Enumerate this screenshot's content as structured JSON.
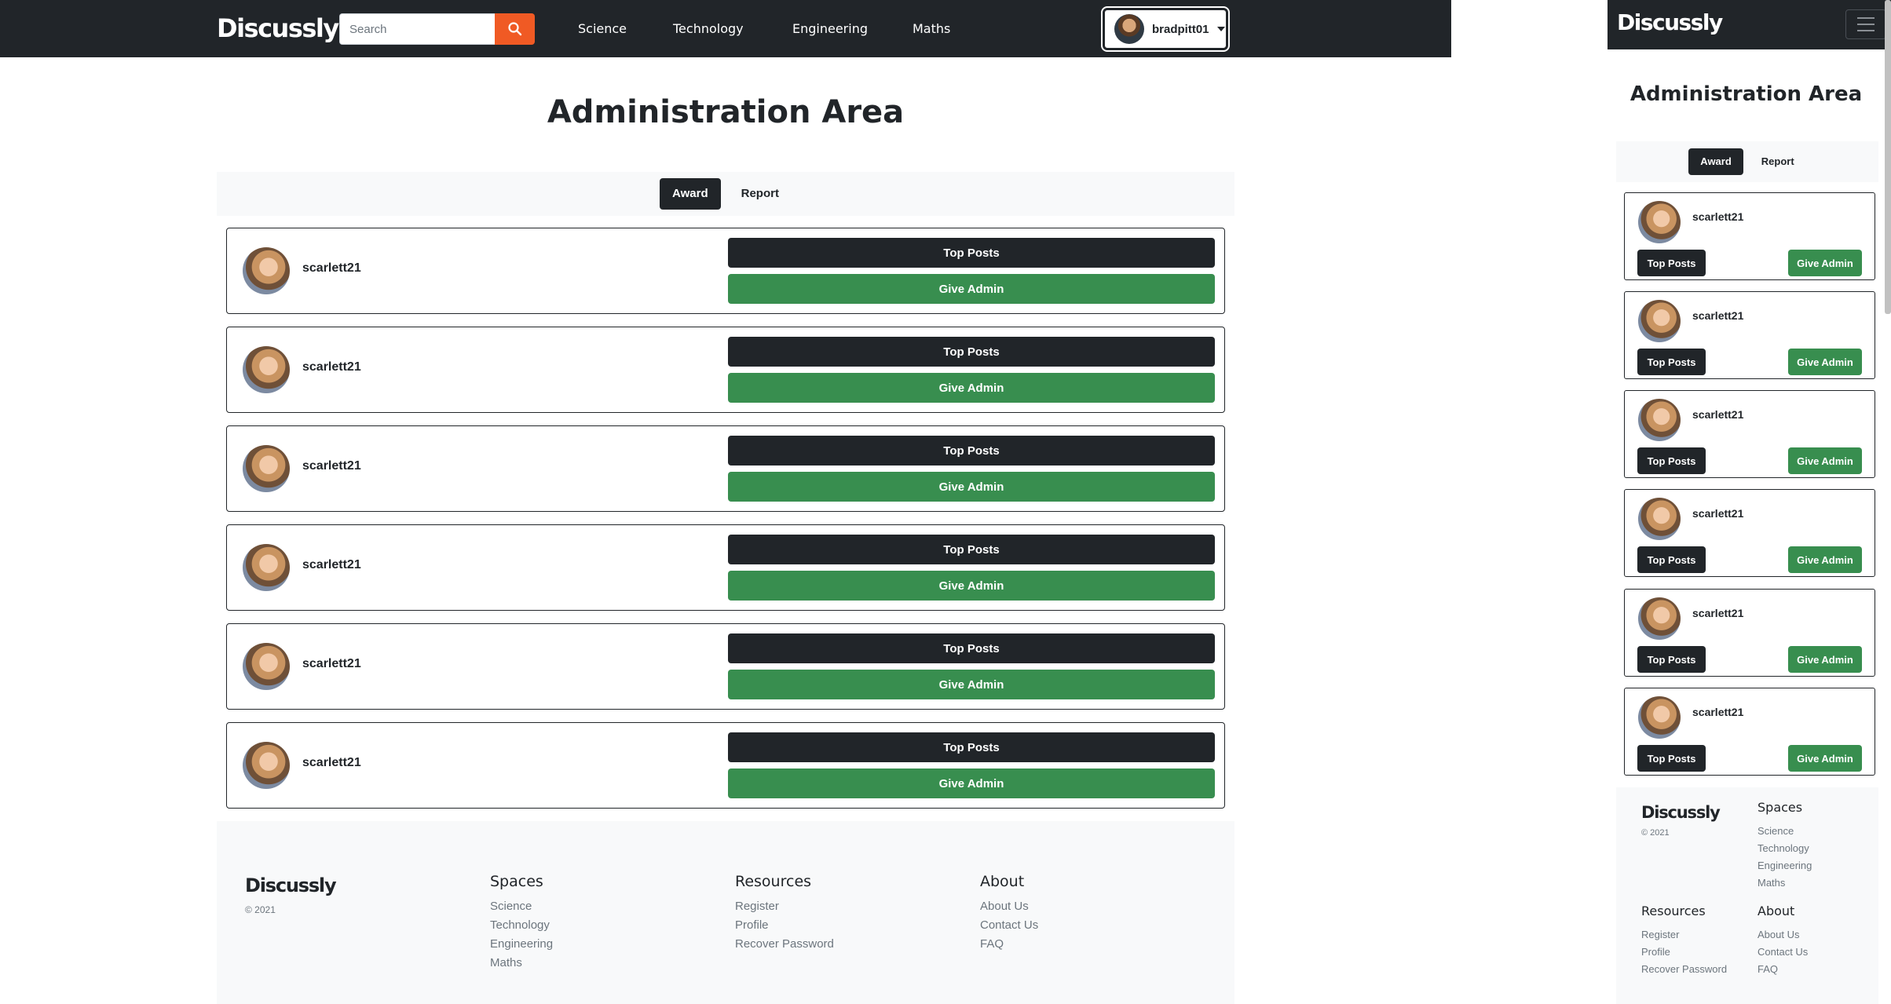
{
  "brand": "Discussly",
  "search": {
    "placeholder": "Search"
  },
  "nav": {
    "links": [
      "Science",
      "Technology",
      "Engineering",
      "Maths"
    ]
  },
  "user": {
    "username": "bradpitt01"
  },
  "page": {
    "title": "Administration Area"
  },
  "tabs": [
    "Award",
    "Report"
  ],
  "active_tab": "Award",
  "users": [
    {
      "name": "scarlett21",
      "top_posts": "Top Posts",
      "give_admin": "Give Admin"
    },
    {
      "name": "scarlett21",
      "top_posts": "Top Posts",
      "give_admin": "Give Admin"
    },
    {
      "name": "scarlett21",
      "top_posts": "Top Posts",
      "give_admin": "Give Admin"
    },
    {
      "name": "scarlett21",
      "top_posts": "Top Posts",
      "give_admin": "Give Admin"
    },
    {
      "name": "scarlett21",
      "top_posts": "Top Posts",
      "give_admin": "Give Admin"
    },
    {
      "name": "scarlett21",
      "top_posts": "Top Posts",
      "give_admin": "Give Admin"
    }
  ],
  "footer": {
    "brand": "Discussly",
    "copyright": "© 2021",
    "spaces": {
      "heading": "Spaces",
      "links": [
        "Science",
        "Technology",
        "Engineering",
        "Maths"
      ]
    },
    "resources": {
      "heading": "Resources",
      "links": [
        "Register",
        "Profile",
        "Recover Password"
      ]
    },
    "about": {
      "heading": "About",
      "links": [
        "About Us",
        "Contact Us",
        "FAQ"
      ]
    }
  },
  "colors": {
    "navbar": "#212529",
    "search_button": "#f05a24",
    "give_admin": "#388e4f",
    "top_posts": "#212529",
    "light_bg": "#f8f9fa"
  },
  "icons": {
    "search": "search-icon",
    "menu": "hamburger-menu-icon",
    "dropdown": "caret-down-icon"
  }
}
